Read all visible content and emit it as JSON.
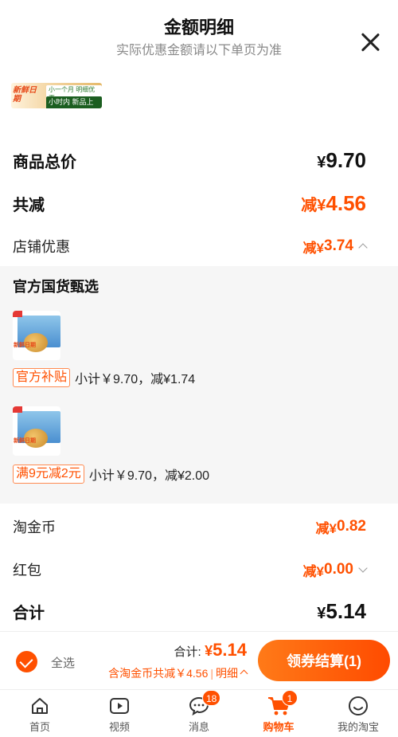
{
  "header": {
    "title": "金额明细",
    "subtitle": "实际优惠金额请以下单页为准"
  },
  "banner": {
    "tag": "新鲜日期",
    "line1": "小一个月 明细优惠",
    "line2": "小时内 新品上市"
  },
  "summary": {
    "goods_total_label": "商品总价",
    "goods_total_yen": "¥",
    "goods_total_value": "9.70",
    "reduce_total_label": "共减",
    "reduce_total_prefix": "减¥",
    "reduce_total_value": "4.56",
    "shop_discount_label": "店铺优惠",
    "shop_discount_prefix": "减¥",
    "shop_discount_value": "3.74"
  },
  "shop": {
    "name": "官方国货甄选",
    "items": [
      {
        "promo_tag": "官方补贴",
        "promo_text": "小计￥9.70，减¥1.74",
        "fresh": "新鲜日期"
      },
      {
        "promo_tag": "满9元减2元",
        "promo_text": "小计￥9.70，减¥2.00",
        "fresh": "新鲜日期"
      }
    ]
  },
  "extras": {
    "coins_label": "淘金币",
    "coins_prefix": "减¥",
    "coins_value": "0.82",
    "redpacket_label": "红包",
    "redpacket_prefix": "减¥",
    "redpacket_value": "0.00",
    "total_label": "合计",
    "total_yen": "¥",
    "total_value": "5.14"
  },
  "checkout": {
    "select_all": "全选",
    "total_label": "合计:",
    "total_yen": "¥",
    "total_value": "5.14",
    "note": "含淘金币共减￥4.56",
    "note_sep": "|",
    "detail": "明细",
    "pay_button": "领券结算(1)"
  },
  "tabbar": {
    "items": [
      {
        "label": "首页",
        "icon": "home-icon"
      },
      {
        "label": "视频",
        "icon": "video-icon"
      },
      {
        "label": "消息",
        "icon": "message-icon",
        "badge": "18"
      },
      {
        "label": "购物车",
        "icon": "cart-icon",
        "badge": "1",
        "active": true
      },
      {
        "label": "我的淘宝",
        "icon": "profile-icon"
      }
    ]
  },
  "colors": {
    "accent": "#ff5000",
    "section_bg": "#f6f6f6"
  }
}
